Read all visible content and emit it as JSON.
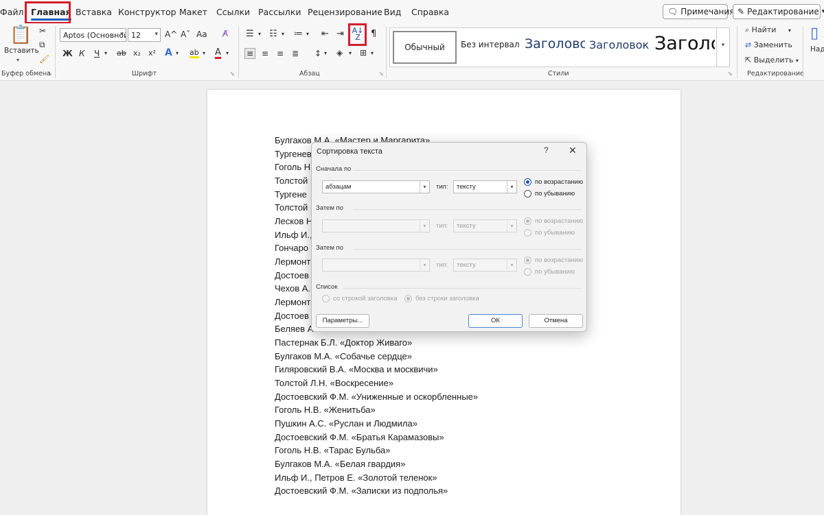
{
  "tabs": [
    "Файл",
    "Главная",
    "Вставка",
    "Конструктор",
    "Макет",
    "Ссылки",
    "Рассылки",
    "Рецензирование",
    "Вид",
    "Справка"
  ],
  "top_buttons": {
    "comments": "Примечания",
    "editing": "Редактирование"
  },
  "ribbon": {
    "clipboard": {
      "paste": "Вставить",
      "label": "Буфер обмена"
    },
    "font": {
      "name": "Aptos (Основной",
      "size": "12",
      "label": "Шрифт",
      "bold": "Ж",
      "italic": "К",
      "underline": "Ч",
      "strike": "ab",
      "sub": "x₂",
      "sup": "x²",
      "grow": "A^",
      "shrink": "Aˇ",
      "case": "Aa",
      "effects": "A",
      "highlight": "ab",
      "color": "A"
    },
    "paragraph": {
      "label": "Абзац"
    },
    "styles": {
      "label": "Стили",
      "items": [
        "Обычный",
        "Без интервал",
        "Заголовс",
        "Заголовок",
        "Заголс"
      ]
    },
    "editing": {
      "label": "Редактирование",
      "find": "Найти",
      "replace": "Заменить",
      "select": "Выделить",
      "partial": "Над"
    }
  },
  "document": {
    "lines": [
      "Булгаков М.А. «Мастер и Маргарита»",
      "Тургенев",
      "Гоголь Н",
      "Толстой",
      "Тургене",
      "Толстой",
      "Лесков Н",
      "Ильф И.,",
      "Гончаро",
      "Лермонт",
      "Достоев",
      "Чехов А.",
      "Лермонт",
      "Достоев",
      "Беляев А",
      "Пастернак Б.Л. «Доктор Живаго»",
      "Булгаков М.А. «Собачье сердце»",
      "Гиляровский В.А. «Москва и москвичи»",
      "Толстой Л.Н. «Воскресение»",
      "Достоевский Ф.М. «Униженные и оскорбленные»",
      "Гоголь Н.В. «Женитьба»",
      "Пушкин А.С. «Руслан и Людмила»",
      "Достоевский Ф.М. «Братья Карамазовы»",
      "Гоголь Н.В. «Тарас Бульба»",
      "Булгаков М.А. «Белая гвардия»",
      "Ильф И., Петров Е. «Золотой теленок»",
      "Достоевский Ф.М. «Записки из подполья»"
    ]
  },
  "dialog": {
    "title": "Сортировка текста",
    "help": "?",
    "close": "✕",
    "sort1": {
      "label": "Сначала по",
      "field": "абзацам",
      "type_label": "тип:",
      "type": "тексту",
      "asc": "по возрастанию",
      "desc": "по убыванию"
    },
    "sort2": {
      "label": "Затем по",
      "field": "",
      "type_label": "тип:",
      "type": "тексту",
      "asc": "по возрастанию",
      "desc": "по убыванию"
    },
    "sort3": {
      "label": "Затем по",
      "field": "",
      "type_label": "тип:",
      "type": "тексту",
      "asc": "по возрастанию",
      "desc": "по убыванию"
    },
    "list": {
      "label": "Список",
      "with_header": "со строкой заголовка",
      "no_header": "без строки заголовка"
    },
    "buttons": {
      "params": "Параметры...",
      "ok": "ОК",
      "cancel": "Отмена"
    }
  },
  "colors": {
    "highlight_red": "#d21e2b",
    "accent_blue": "#1f5cbf"
  }
}
